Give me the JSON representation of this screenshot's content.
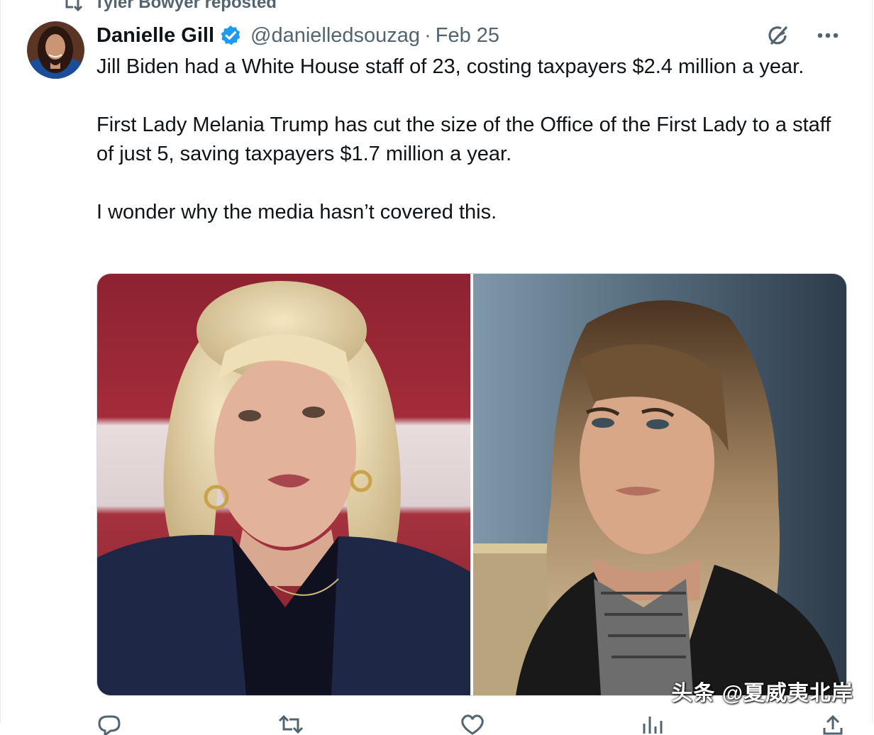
{
  "repost": {
    "text": "Tyler Bowyer reposted",
    "icon": "repost-icon"
  },
  "author": {
    "name": "Danielle Gill",
    "handle": "@danielledsouzag",
    "separator": "·",
    "date": "Feb 25",
    "verified": true,
    "verified_color": "#1d9bf0"
  },
  "tweet": {
    "paragraphs": [
      "Jill Biden had a White House staff of 23, costing taxpayers $2.4 million a year.",
      "First Lady Melania Trump has cut the size of the Office of the First Lady to a staff of just 5, saving taxpayers $1.7 million a year.",
      "I wonder why the media hasn’t covered this."
    ]
  },
  "actions": {
    "grok_icon": "grok-icon",
    "more_icon": "more-icon"
  },
  "media": [
    {
      "icon": "photo-jill-biden"
    },
    {
      "icon": "photo-melania-trump"
    }
  ],
  "watermark": "头条 @夏威夷北岸",
  "colors": {
    "text": "#0f1419",
    "secondary": "#536471",
    "accent": "#1d9bf0",
    "border": "#cfd9de"
  }
}
